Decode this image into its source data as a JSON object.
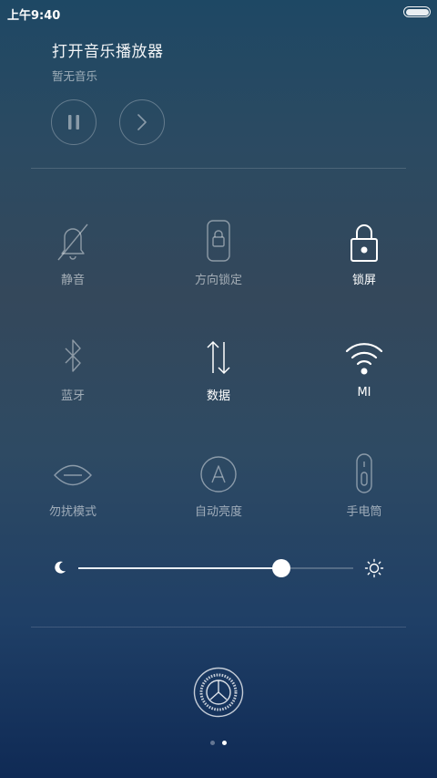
{
  "status_bar": {
    "time": "上午9:40",
    "battery_icon": "battery-icon"
  },
  "music": {
    "title": "打开音乐播放器",
    "subtitle": "暂无音乐",
    "pause_icon": "pause-icon",
    "next_icon": "chevron-right-icon"
  },
  "toggles": [
    {
      "label": "静音",
      "icon": "bell-muted-icon",
      "active": false
    },
    {
      "label": "方向锁定",
      "icon": "rotation-lock-icon",
      "active": false
    },
    {
      "label": "锁屏",
      "icon": "lock-icon",
      "active": true
    },
    {
      "label": "蓝牙",
      "icon": "bluetooth-icon",
      "active": false
    },
    {
      "label": "数据",
      "icon": "mobile-data-icon",
      "active": true
    },
    {
      "label": "MI",
      "icon": "wifi-icon",
      "active": true
    },
    {
      "label": "勿扰模式",
      "icon": "do-not-disturb-icon",
      "active": false
    },
    {
      "label": "自动亮度",
      "icon": "auto-brightness-icon",
      "active": false
    },
    {
      "label": "手电筒",
      "icon": "flashlight-icon",
      "active": false
    }
  ],
  "brightness": {
    "level_percent": 74,
    "low_icon": "moon-icon",
    "high_icon": "sun-icon"
  },
  "settings": {
    "icon": "gear-icon"
  },
  "pager": {
    "pages": 2,
    "current": 2
  },
  "colors": {
    "active": "#ffffff",
    "inactive": "rgba(255,255,255,0.55)"
  }
}
